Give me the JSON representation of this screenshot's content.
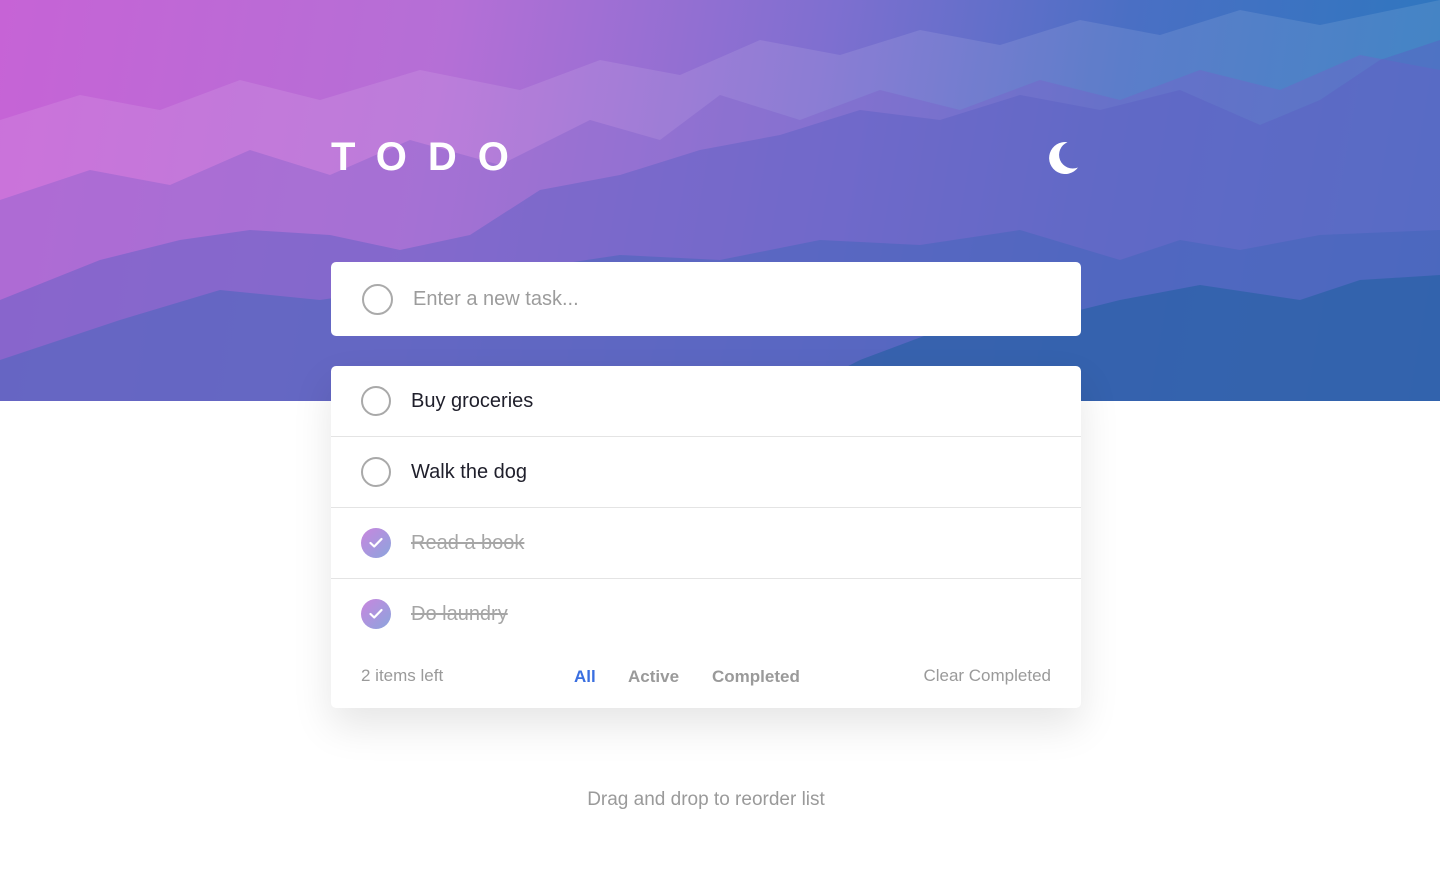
{
  "app": {
    "title": "TODO",
    "theme_toggle_icon": "moon-icon"
  },
  "new_task": {
    "placeholder": "Enter a new task...",
    "value": ""
  },
  "todos": [
    {
      "text": "Buy groceries",
      "completed": false
    },
    {
      "text": "Walk the dog",
      "completed": false
    },
    {
      "text": "Read a book",
      "completed": true
    },
    {
      "text": "Do laundry",
      "completed": true
    }
  ],
  "footer": {
    "items_left": "2 items left",
    "filters": [
      {
        "label": "All",
        "active": true
      },
      {
        "label": "Active",
        "active": false
      },
      {
        "label": "Completed",
        "active": false
      }
    ],
    "clear_label": "Clear Completed"
  },
  "hint": "Drag and drop to reorder list",
  "colors": {
    "accent": "#3a6fe0",
    "check_gradient_start": "#c986de",
    "check_gradient_end": "#8aa5dd",
    "hero_start": "#c663d6",
    "hero_end": "#2a78be"
  }
}
